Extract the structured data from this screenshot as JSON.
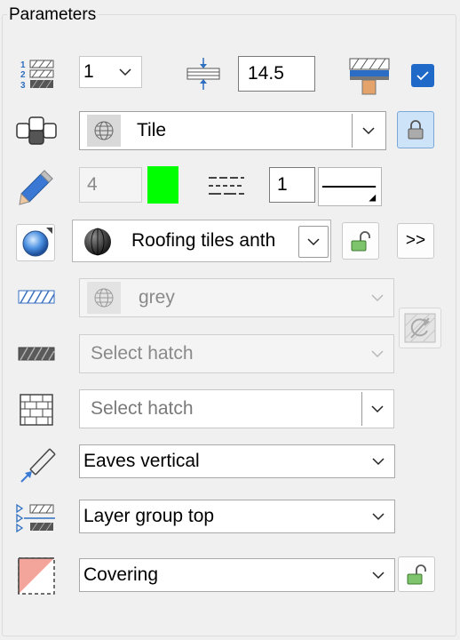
{
  "panel": {
    "title": "Parameters"
  },
  "row1": {
    "layer_number": "1",
    "thickness": "14.5",
    "checkbox_checked": true
  },
  "row2": {
    "material_value": "Tile"
  },
  "row3": {
    "pen_value": "4",
    "pen_color": "#00ff00",
    "line_value": "1"
  },
  "row4": {
    "surface_value": "Roofing tiles anth",
    "more_label": ">>"
  },
  "row5": {
    "color_value": "grey"
  },
  "row6": {
    "hatch1_placeholder": "Select hatch"
  },
  "row7": {
    "hatch2_placeholder": "Select hatch"
  },
  "row8": {
    "eaves_value": "Eaves vertical"
  },
  "row9": {
    "layer_group_value": "Layer group top"
  },
  "row10": {
    "covering_value": "Covering"
  },
  "icons": [
    "layer-numbering-icon",
    "layer-thickness-icon",
    "roof-cover-icon",
    "component-icon",
    "pen-icon",
    "line-type-icon",
    "surface-sphere-icon",
    "texture-ball-icon",
    "hatch-blue-icon",
    "hatch-gray-icon",
    "brick-pattern-icon",
    "eaves-icon",
    "layer-group-icon",
    "covering-icon",
    "lock-icon",
    "unlock-icon",
    "reset-icon"
  ],
  "colors": {
    "accent": "#0068c8",
    "pen_swatch": "#00ff00",
    "covering_fill": "#f3a59b"
  }
}
